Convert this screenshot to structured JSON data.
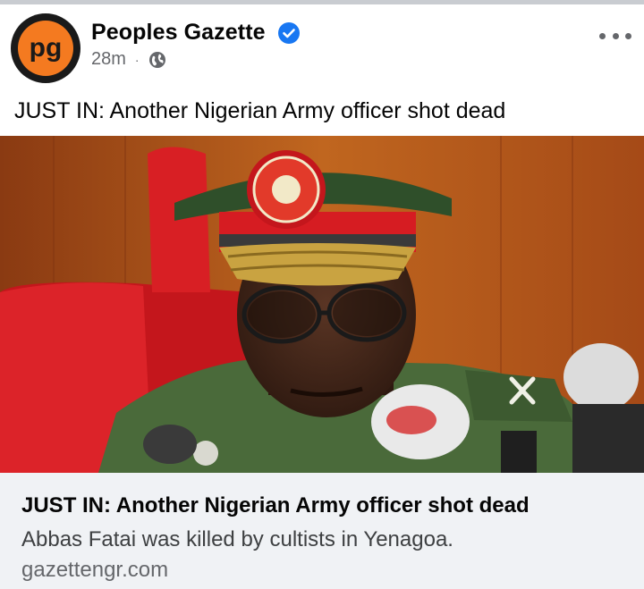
{
  "post": {
    "page_name": "Peoples Gazette",
    "timestamp": "28m",
    "separator": "·",
    "text": "JUST IN: Another Nigerian Army officer shot dead",
    "avatar_icon": "peoples-gazette-logo",
    "verified_icon": "verified-badge-icon",
    "audience_icon": "globe-icon",
    "menu_icon": "more-options-icon"
  },
  "link_preview": {
    "title": "JUST IN: Another Nigerian Army officer shot dead",
    "description": "Abbas Fatai was killed by cultists in Yenagoa.",
    "domain": "gazettengr.com"
  },
  "colors": {
    "brand_orange": "#f47a20",
    "verified_blue": "#1877f2",
    "secondary_text": "#65676b",
    "preview_bg": "#f0f2f5"
  }
}
